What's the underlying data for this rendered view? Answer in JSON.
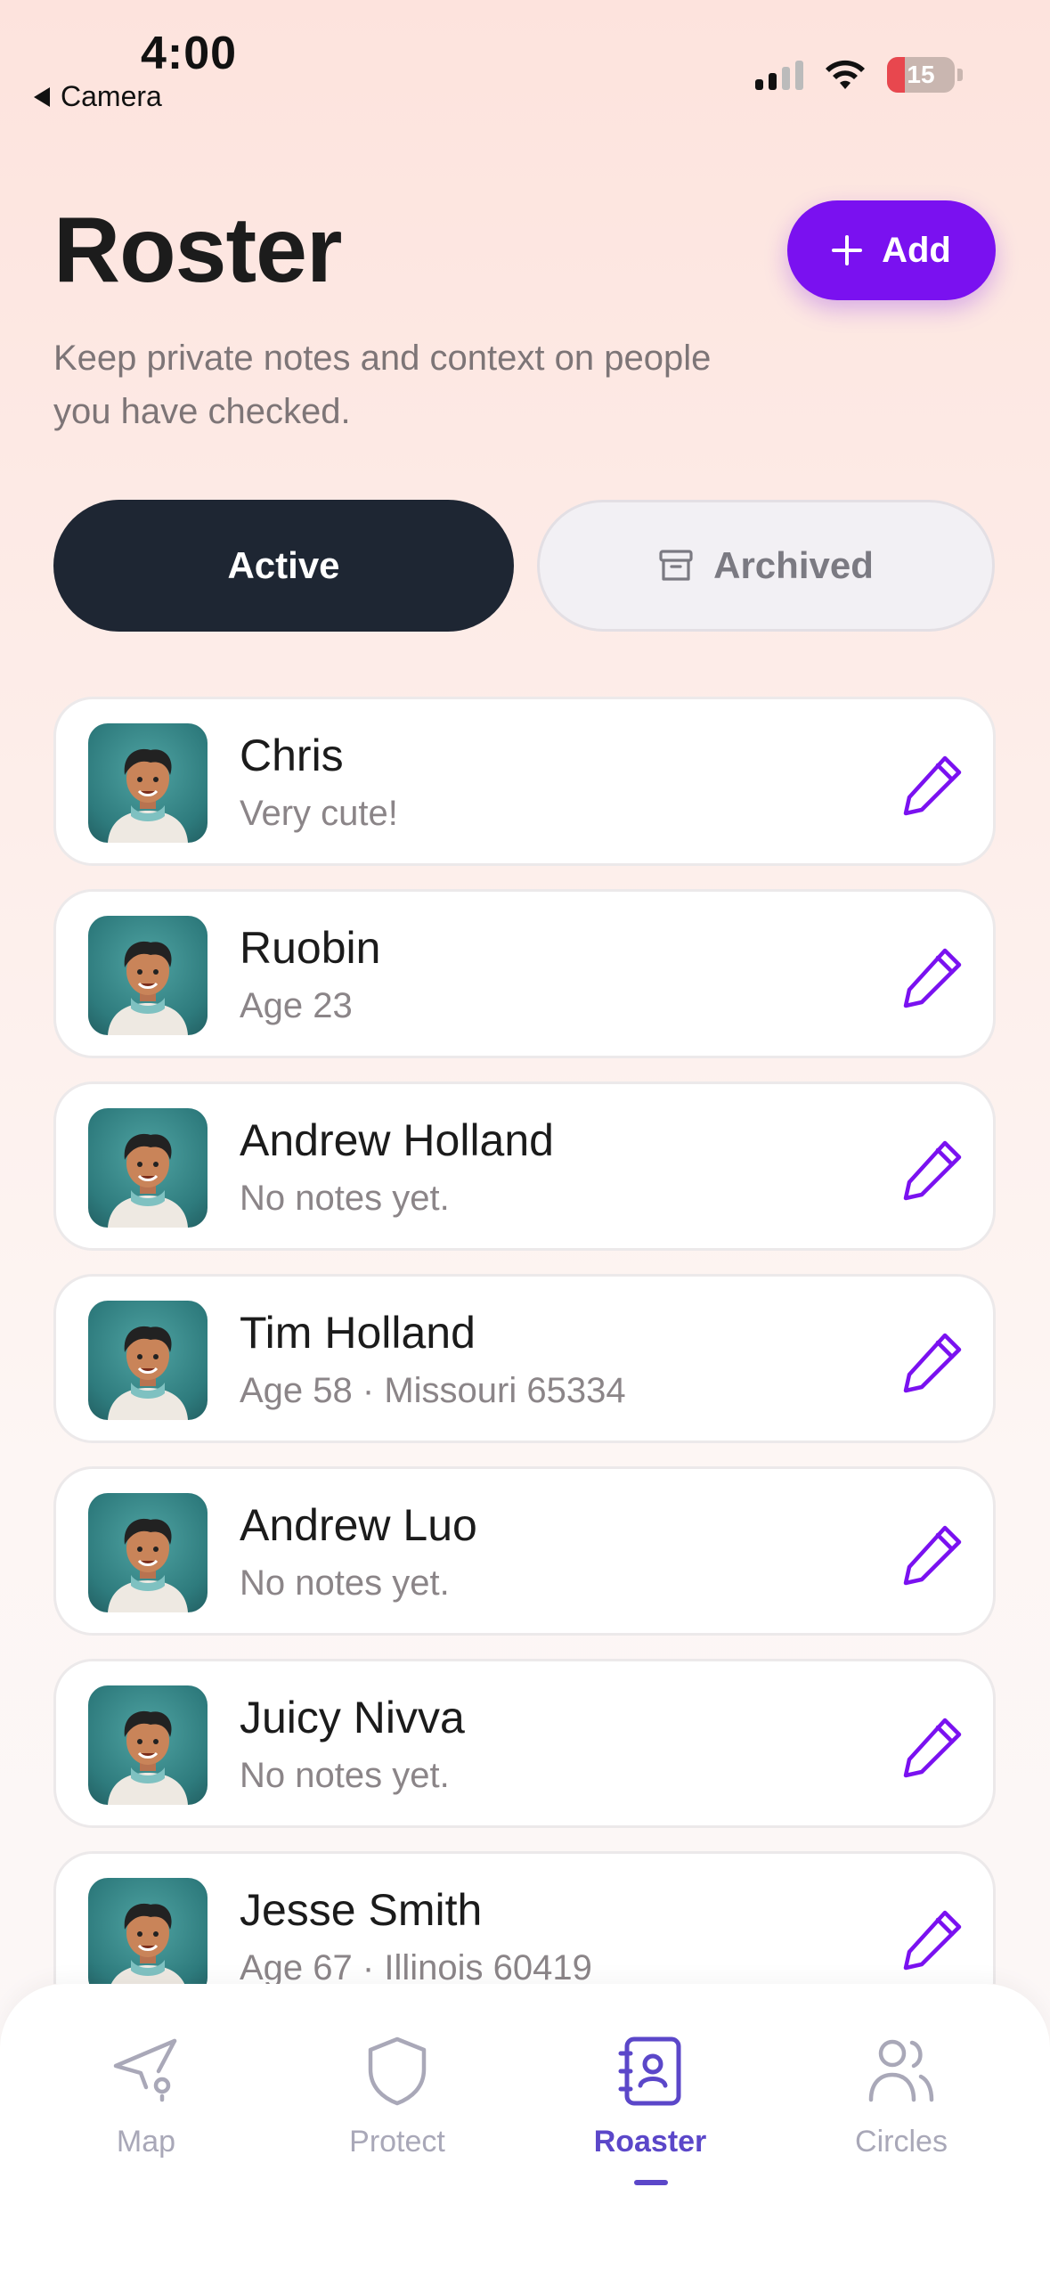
{
  "status_bar": {
    "time": "4:00",
    "back_label": "Camera",
    "battery_level": "15"
  },
  "header": {
    "title": "Roster",
    "add_label": "Add",
    "subtitle": "Keep private notes and context on people you have checked."
  },
  "tabs": {
    "active_label": "Active",
    "archived_label": "Archived"
  },
  "people": [
    {
      "name": "Chris",
      "note": "Very cute!"
    },
    {
      "name": "Ruobin",
      "note": "Age 23"
    },
    {
      "name": "Andrew Holland",
      "note": "No notes yet."
    },
    {
      "name": "Tim Holland",
      "note": "Age 58 · Missouri 65334"
    },
    {
      "name": "Andrew Luo",
      "note": "No notes yet."
    },
    {
      "name": "Juicy Nivva",
      "note": "No notes yet."
    },
    {
      "name": "Jesse Smith",
      "note": "Age 67 · Illinois 60419"
    }
  ],
  "nav": {
    "items": [
      {
        "label": "Map",
        "icon": "map-pin-icon"
      },
      {
        "label": "Protect",
        "icon": "shield-icon"
      },
      {
        "label": "Roaster",
        "icon": "contacts-book-icon"
      },
      {
        "label": "Circles",
        "icon": "users-icon"
      }
    ],
    "active_index": 2
  },
  "colors": {
    "accent": "#7a11f0",
    "active_tab": "#1e2633",
    "nav_active": "#5b47c9"
  }
}
